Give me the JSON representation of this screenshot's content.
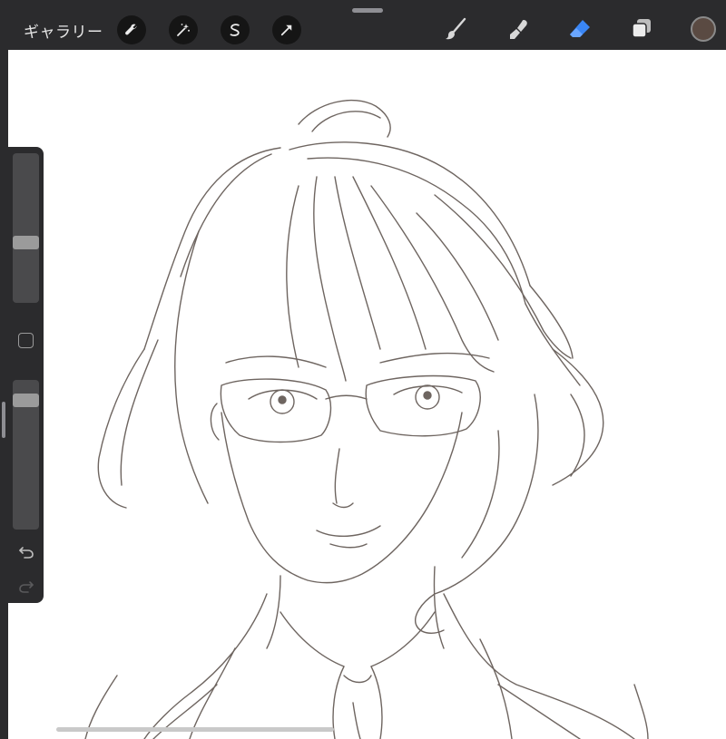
{
  "toolbar": {
    "gallery_label": "ギャラリー",
    "left_tools": [
      "wrench-icon",
      "magic-wand-icon",
      "selection-icon",
      "transform-arrow-icon"
    ],
    "right_tools": [
      "brush-icon",
      "smudge-icon",
      "eraser-icon",
      "layers-icon"
    ],
    "active_tool": "eraser",
    "active_color": "#5a4a42",
    "accent_color": "#3a86f5"
  },
  "sidebar": {
    "brush_size_level": 0.58,
    "opacity_level": 0.88,
    "modifier_icon": "square-modifier-icon",
    "undo_icon": "undo-icon",
    "redo_icon": "redo-icon"
  },
  "canvas": {
    "content": "sketch-drawing",
    "scroll_icon": "horizontal-scrollbar"
  }
}
